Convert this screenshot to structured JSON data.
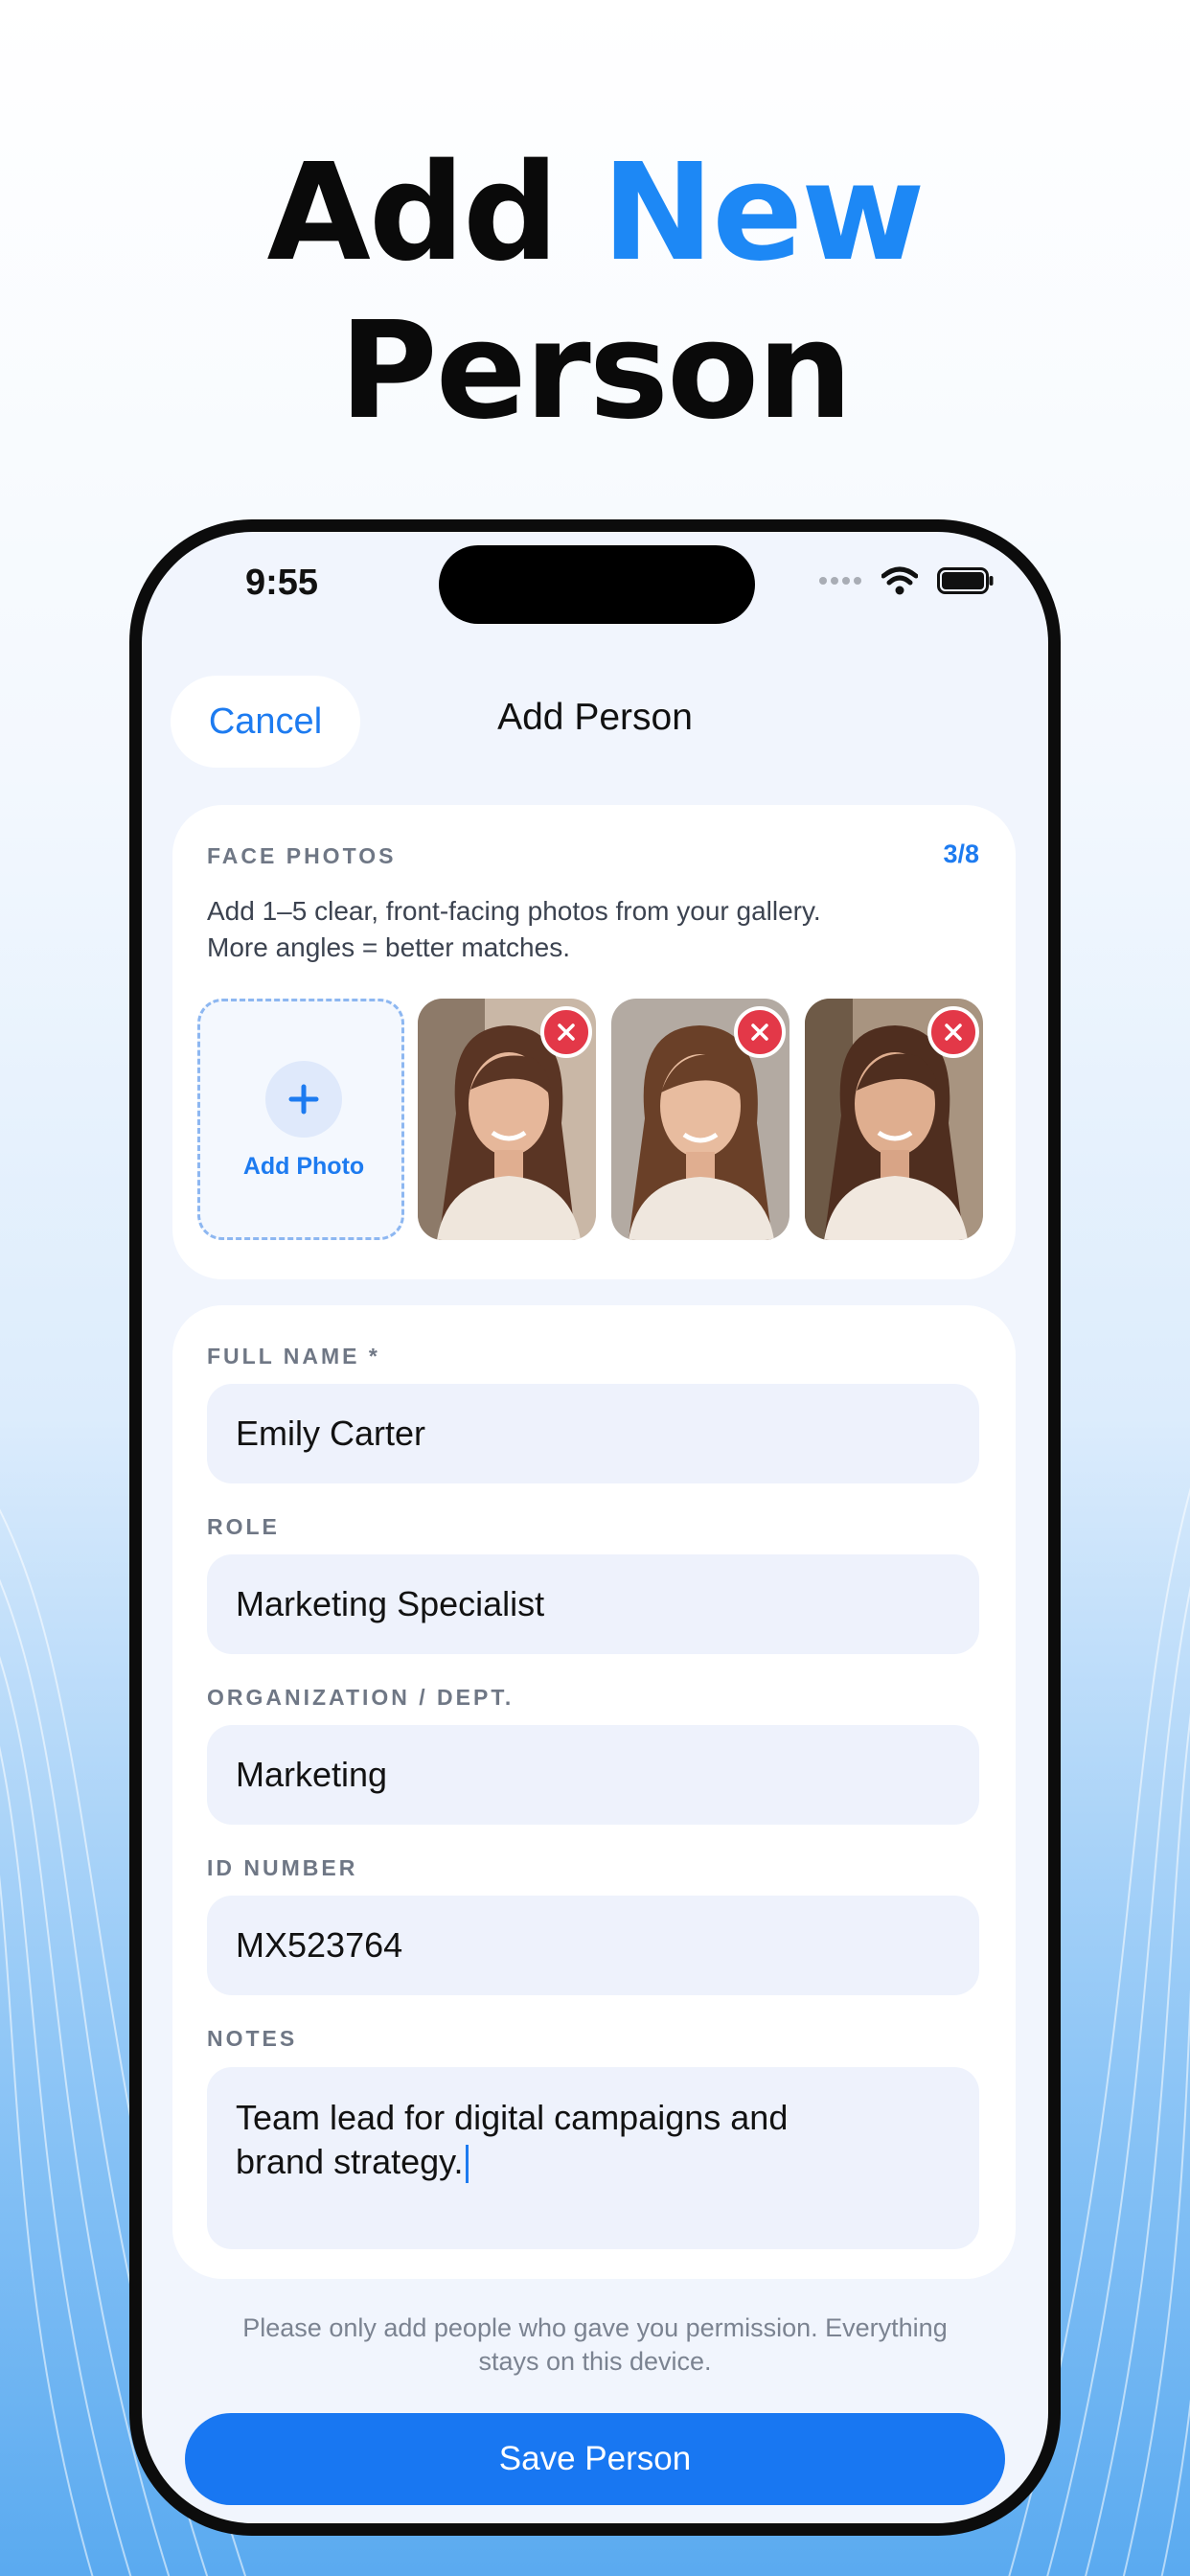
{
  "headline": {
    "line1_plain": "Add",
    "line1_accent": "New",
    "line2": "Person"
  },
  "status_bar": {
    "time": "9:55",
    "icons": [
      "signal-dots-icon",
      "wifi-icon",
      "battery-icon"
    ]
  },
  "nav": {
    "cancel_label": "Cancel",
    "title": "Add Person"
  },
  "photos_section": {
    "label": "FACE PHOTOS",
    "counter": "3/8",
    "helper_line1": "Add 1–5 clear, front-facing photos from your gallery.",
    "helper_line2": "More angles = better matches.",
    "add_label": "Add Photo"
  },
  "form": {
    "full_name": {
      "label": "FULL NAME *",
      "value": "Emily Carter"
    },
    "role": {
      "label": "ROLE",
      "value": "Marketing Specialist"
    },
    "organization": {
      "label": "ORGANIZATION / DEPT.",
      "value": "Marketing"
    },
    "id_number": {
      "label": "ID NUMBER",
      "value": "MX523764"
    },
    "notes": {
      "label": "NOTES",
      "line1": "Team lead for digital campaigns and",
      "line2": "brand strategy."
    }
  },
  "disclaimer": {
    "line1": "Please only add people who gave you permission. Everything",
    "line2": "stays on this device."
  },
  "save_label": "Save Person",
  "colors": {
    "accent": "#1d7bf0",
    "save_button": "#1877f2",
    "remove": "#e33848"
  }
}
